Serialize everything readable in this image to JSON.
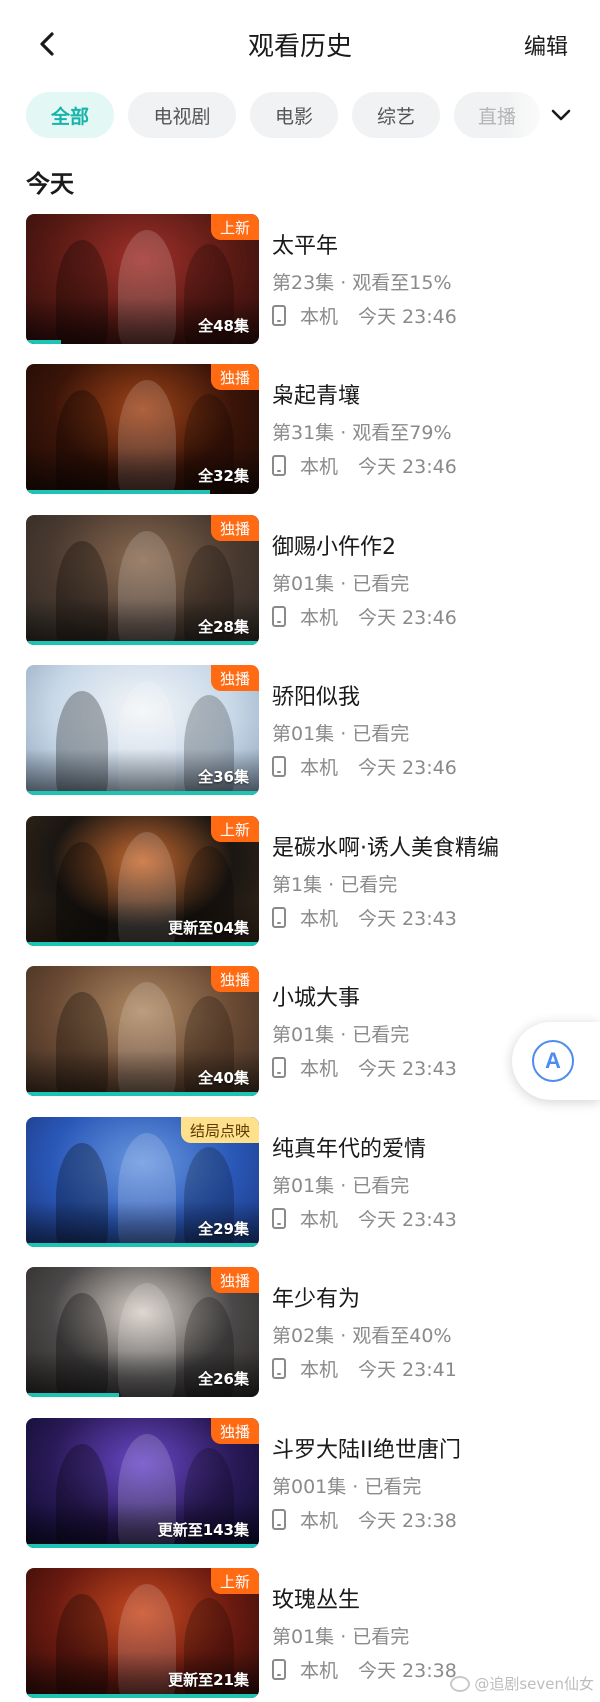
{
  "header": {
    "title": "观看历史",
    "edit_label": "编辑"
  },
  "filters": [
    {
      "label": "全部",
      "active": true
    },
    {
      "label": "电视剧",
      "active": false
    },
    {
      "label": "电影",
      "active": false
    },
    {
      "label": "综艺",
      "active": false
    },
    {
      "label": "直播",
      "active": false
    }
  ],
  "section_title": "今天",
  "items": [
    {
      "title": "太平年",
      "episode": "第23集 · 观看至15%",
      "device": "本机",
      "time": "今天 23:46",
      "badge": "上新",
      "badge_style": "orange",
      "count": "全48集",
      "progress": 0.15,
      "colors": [
        "#5a1a14",
        "#a0302a",
        "#2a0c0a"
      ]
    },
    {
      "title": "枭起青壤",
      "episode": "第31集 · 观看至79%",
      "device": "本机",
      "time": "今天 23:46",
      "badge": "独播",
      "badge_style": "orange",
      "count": "全32集",
      "progress": 0.79,
      "colors": [
        "#3a1408",
        "#a04418",
        "#1a0a06"
      ]
    },
    {
      "title": "御赐小仵作2",
      "episode": "第01集 · 已看完",
      "device": "本机",
      "time": "今天 23:46",
      "badge": "独播",
      "badge_style": "orange",
      "count": "全28集",
      "progress": 1.0,
      "colors": [
        "#4a3a30",
        "#8a6a50",
        "#2a2824"
      ]
    },
    {
      "title": "骄阳似我",
      "episode": "第01集 · 已看完",
      "device": "本机",
      "time": "今天 23:46",
      "badge": "独播",
      "badge_style": "orange",
      "count": "全36集",
      "progress": 1.0,
      "colors": [
        "#c8d8e8",
        "#f4f6f8",
        "#8aa0b8"
      ]
    },
    {
      "title": "是碳水啊·诱人美食精编",
      "episode": "第1集 · 已看完",
      "device": "本机",
      "time": "今天 23:43",
      "badge": "上新",
      "badge_style": "orange",
      "count": "更新至04集",
      "progress": 1.0,
      "colors": [
        "#1a1612",
        "#c86a30",
        "#3a2a1a"
      ]
    },
    {
      "title": "小城大事",
      "episode": "第01集 · 已看完",
      "device": "本机",
      "time": "今天 23:43",
      "badge": "独播",
      "badge_style": "orange",
      "count": "全40集",
      "progress": 1.0,
      "colors": [
        "#6a4a34",
        "#b08a64",
        "#3a2a20"
      ]
    },
    {
      "title": "纯真年代的爱情",
      "episode": "第01集 · 已看完",
      "device": "本机",
      "time": "今天 23:43",
      "badge": "结局点映",
      "badge_style": "yellow",
      "count": "全29集",
      "progress": 1.0,
      "colors": [
        "#2a58b8",
        "#6a98e0",
        "#1a3478"
      ]
    },
    {
      "title": "年少有为",
      "episode": "第02集 · 观看至40%",
      "device": "本机",
      "time": "今天 23:41",
      "badge": "独播",
      "badge_style": "orange",
      "count": "全26集",
      "progress": 0.4,
      "colors": [
        "#4a4848",
        "#d8d0c8",
        "#2a2624"
      ]
    },
    {
      "title": "斗罗大陆II绝世唐门",
      "episode": "第001集 · 已看完",
      "device": "本机",
      "time": "今天 23:38",
      "badge": "独播",
      "badge_style": "orange",
      "count": "更新至143集",
      "progress": 1.0,
      "colors": [
        "#2a1a58",
        "#6a48c8",
        "#0a0a28"
      ]
    },
    {
      "title": "玫瑰丛生",
      "episode": "第01集 · 已看完",
      "device": "本机",
      "time": "今天 23:38",
      "badge": "上新",
      "badge_style": "orange",
      "count": "更新至21集",
      "progress": 1.0,
      "colors": [
        "#6a1a10",
        "#c84a20",
        "#2a0a08"
      ]
    }
  ],
  "float_button": {
    "letter": "A",
    "icon": "translate-scan-icon"
  },
  "watermark": "@追剧seven仙女",
  "colors": {
    "accent": "#17b4a9",
    "badge_orange": "#ff6a13",
    "badge_yellow": "#ffe08c",
    "progress": "#1fc3b4"
  }
}
